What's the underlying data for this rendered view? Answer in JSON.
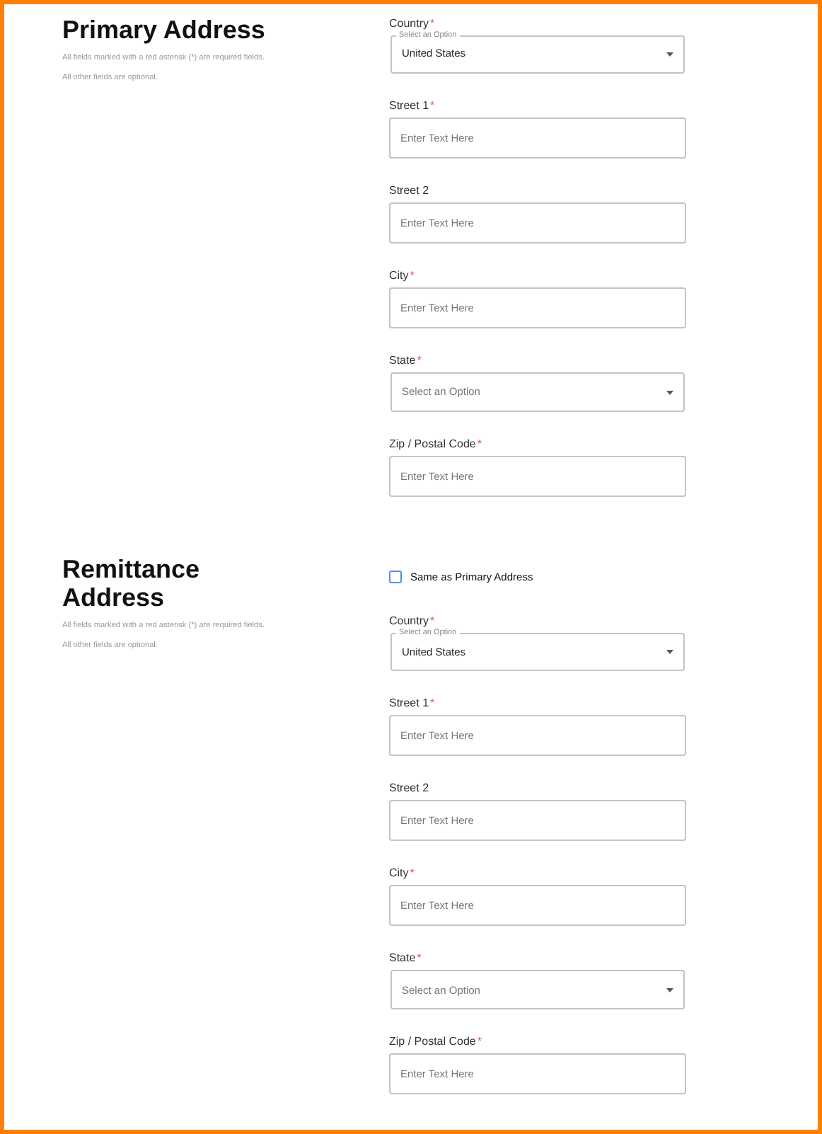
{
  "sections": [
    {
      "title": "Primary Address",
      "notes": [
        "All fields marked with a red asterisk (*) are required fields.",
        "All other fields are optional."
      ],
      "fields": [
        {
          "kind": "select",
          "label": "Country",
          "mark": "*",
          "floating_label": "Select an Option",
          "value": "United States"
        },
        {
          "kind": "text",
          "label": "Street 1",
          "mark": "*",
          "placeholder": "Enter Text Here"
        },
        {
          "kind": "text",
          "label": "Street 2",
          "placeholder": "Enter Text Here"
        },
        {
          "kind": "text",
          "label": "City",
          "mark": "*",
          "placeholder": "Enter Text Here"
        },
        {
          "kind": "select",
          "label": "State",
          "mark": "*",
          "placeholder": "Select an Option"
        },
        {
          "kind": "text",
          "label": "Zip / Postal Code",
          "mark": "*",
          "placeholder": "Enter Text Here"
        }
      ]
    },
    {
      "title": "Remittance Address",
      "notes": [
        "All fields marked with a red asterisk (*) are required fields.",
        "All other fields are optional."
      ],
      "checkbox": {
        "label": "Same as Primary Address",
        "checked": false
      },
      "fields": [
        {
          "kind": "select",
          "label": "Country",
          "mark": "*",
          "floating_label": "Select an Option",
          "value": "United States"
        },
        {
          "kind": "text",
          "label": "Street 1",
          "mark": "*",
          "placeholder": "Enter Text Here"
        },
        {
          "kind": "text",
          "label": "Street 2",
          "placeholder": "Enter Text Here"
        },
        {
          "kind": "text",
          "label": "City",
          "mark": "*",
          "placeholder": "Enter Text Here"
        },
        {
          "kind": "select",
          "label": "State",
          "mark": "*",
          "placeholder": "Select an Option"
        },
        {
          "kind": "text",
          "label": "Zip / Postal Code",
          "mark": "*",
          "placeholder": "Enter Text Here"
        }
      ]
    }
  ]
}
